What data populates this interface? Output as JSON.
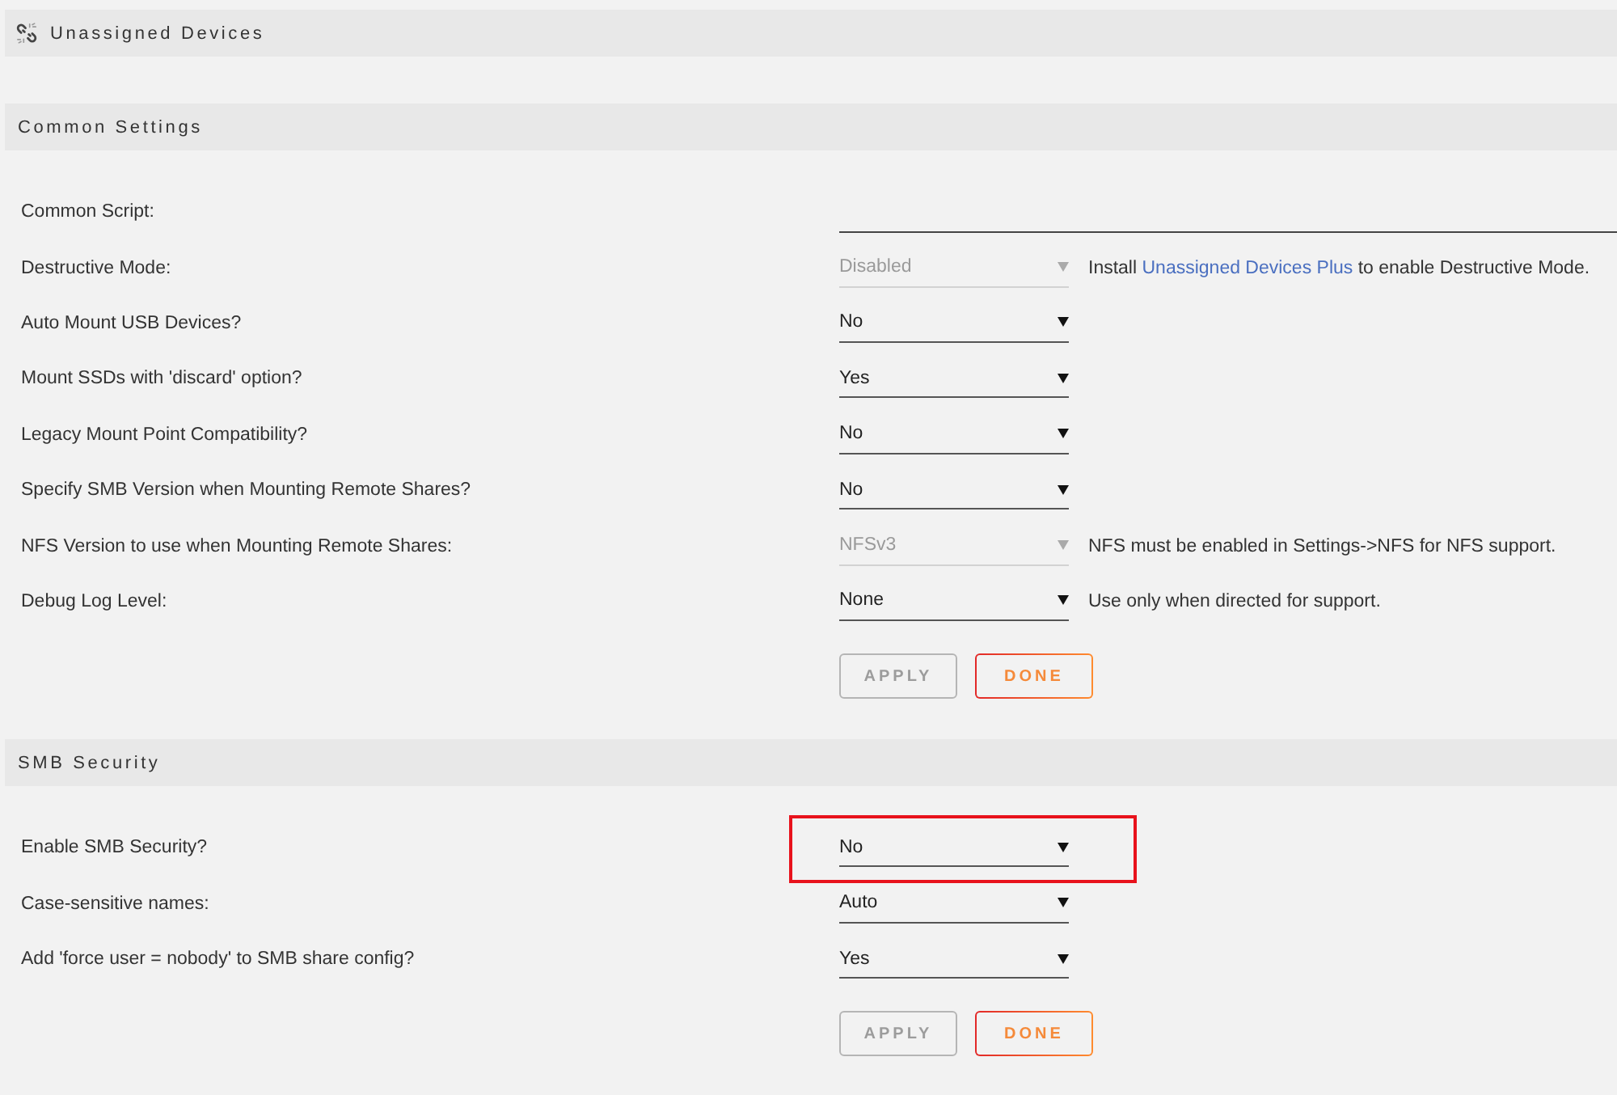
{
  "page": {
    "title": "Unassigned Devices"
  },
  "sections": [
    {
      "title": "Common Settings",
      "settings": [
        {
          "kind": "text",
          "label": "Common Script:"
        },
        {
          "kind": "select",
          "label": "Destructive Mode:",
          "value": "Disabled",
          "disabled": true,
          "help": [
            {
              "kind": "text",
              "text": "Install "
            },
            {
              "kind": "link",
              "text": "Unassigned Devices Plus"
            },
            {
              "kind": "text",
              "text": " to enable Destructive Mode."
            }
          ]
        },
        {
          "kind": "select",
          "label": "Auto Mount USB Devices?",
          "value": "No",
          "disabled": false
        },
        {
          "kind": "select",
          "label": "Mount SSDs with 'discard' option?",
          "value": "Yes",
          "disabled": false
        },
        {
          "kind": "select",
          "label": "Legacy Mount Point Compatibility?",
          "value": "No",
          "disabled": false
        },
        {
          "kind": "select",
          "label": "Specify SMB Version when Mounting Remote Shares?",
          "value": "No",
          "disabled": false
        },
        {
          "kind": "select",
          "label": "NFS Version to use when Mounting Remote Shares:",
          "value": "NFSv3",
          "disabled": true,
          "help": [
            {
              "kind": "text",
              "text": "NFS must be enabled in Settings->NFS for NFS support."
            }
          ]
        },
        {
          "kind": "select",
          "label": "Debug Log Level:",
          "value": "None",
          "disabled": false,
          "help": [
            {
              "kind": "text",
              "text": "Use only when directed for support."
            }
          ]
        }
      ],
      "buttons": [
        {
          "label": "APPLY",
          "disabled": true
        },
        {
          "label": "DONE",
          "disabled": false
        }
      ]
    },
    {
      "title": "SMB Security",
      "settings": [
        {
          "kind": "select",
          "label": "Enable SMB Security?",
          "value": "No",
          "disabled": false,
          "highlighted": true
        },
        {
          "kind": "select",
          "label": "Case-sensitive names:",
          "value": "Auto",
          "disabled": false,
          "highlighted": false
        },
        {
          "kind": "select",
          "label": "Add 'force user = nobody' to SMB share config?",
          "value": "Yes",
          "disabled": false,
          "highlighted": false
        }
      ],
      "buttons": [
        {
          "label": "APPLY",
          "disabled": true
        },
        {
          "label": "DONE",
          "disabled": false
        }
      ]
    }
  ]
}
